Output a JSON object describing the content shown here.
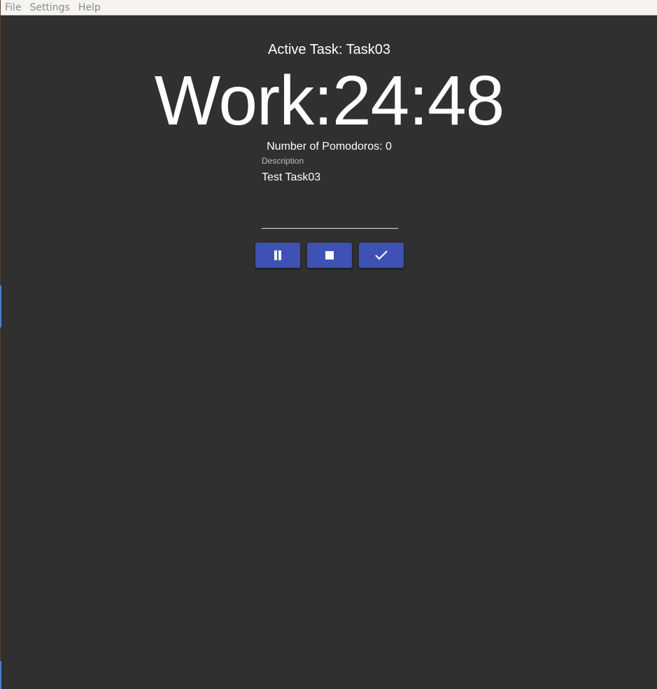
{
  "menubar": {
    "items": [
      {
        "label": "File"
      },
      {
        "label": "Settings"
      },
      {
        "label": "Help"
      }
    ]
  },
  "timer": {
    "active_task": "Active Task: Task03",
    "display": "Work:24:48",
    "pomodoros": "Number of Pomodoros: 0"
  },
  "description": {
    "label": "Description",
    "value": "Test Task03"
  },
  "controls": {
    "buttons": [
      {
        "icon": "pause-icon"
      },
      {
        "icon": "stop-icon"
      },
      {
        "icon": "check-icon"
      }
    ]
  },
  "colors": {
    "background": "#303030",
    "button": "#3f51b5",
    "text": "#ffffff"
  }
}
